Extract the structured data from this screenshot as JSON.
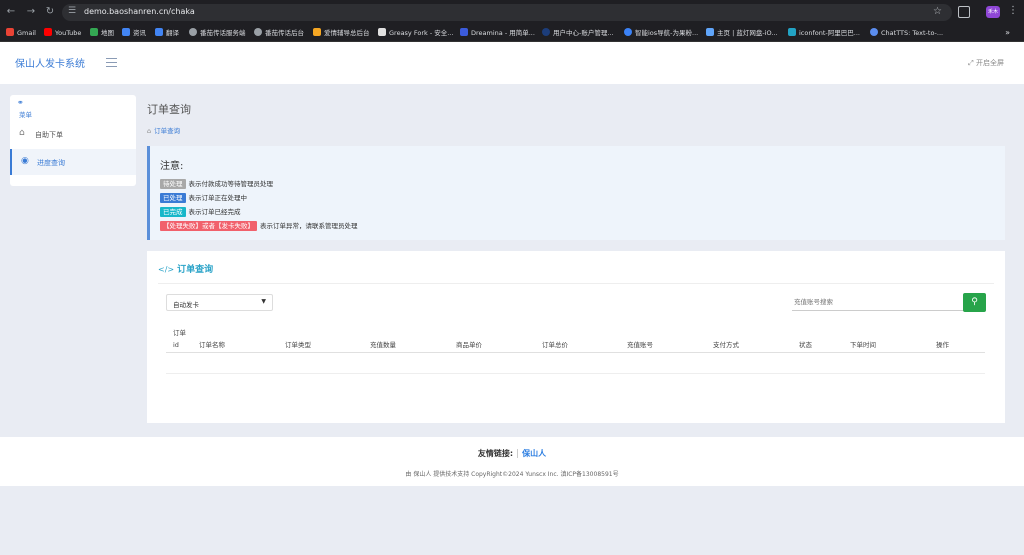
{
  "browser": {
    "url": "demo.baoshanren.cn/chaka",
    "profile_label": "禾木",
    "bookmarks": [
      {
        "label": "Gmail",
        "color": "#ea4335"
      },
      {
        "label": "YouTube",
        "color": "#ff0000"
      },
      {
        "label": "地图",
        "color": "#34a853"
      },
      {
        "label": "资讯",
        "color": "#4285f4"
      },
      {
        "label": "翻译",
        "color": "#4285f4"
      },
      {
        "label": "番茄传话服务端",
        "color": "#9aa0a6"
      },
      {
        "label": "番茄传话后台",
        "color": "#9aa0a6"
      },
      {
        "label": "爱情辅导总后台",
        "color": "#f5a623"
      },
      {
        "label": "Greasy Fork - 安全...",
        "color": "#222222"
      },
      {
        "label": "Dreamina - 用简单...",
        "color": "#3b5bdb"
      },
      {
        "label": "用户中心-账户管理...",
        "color": "#1c3d7a"
      },
      {
        "label": "智能ios导航-为果粉...",
        "color": "#3b82f6"
      },
      {
        "label": "主页 | 蓝灯网盘-iO...",
        "color": "#60a5fa"
      },
      {
        "label": "iconfont-阿里巴巴...",
        "color": "#22a3c4"
      },
      {
        "label": "ChatTTS: Text-to-...",
        "color": "#5b8def"
      }
    ]
  },
  "header": {
    "brand": "保山人发卡系统",
    "fullscreen_label": "开启全屏"
  },
  "sidebar": {
    "menu_label": "菜单",
    "items": [
      {
        "label": "自助下单",
        "icon": "home-icon"
      },
      {
        "label": "进度查询",
        "icon": "eye-icon"
      }
    ]
  },
  "main": {
    "page_title": "订单查询",
    "breadcrumb": "订单查询",
    "notice": {
      "title": "注意:",
      "rows": [
        {
          "badge": "待处理",
          "badge_color": "#a8a8a8",
          "text": "表示付款成功等待管理员处理"
        },
        {
          "badge": "已处理",
          "badge_color": "#3a7bd5",
          "text": "表示订单正在处理中"
        },
        {
          "badge": "已完成",
          "badge_color": "#18b7c9",
          "text": "表示订单已经完成"
        },
        {
          "badge": "【处理失败】或者【发卡失败】",
          "badge_color": "#f1616c",
          "text": "表示订单异常，请联系管理员处理"
        }
      ]
    },
    "query_card": {
      "title": "订单查询",
      "select_value": "自动发卡",
      "search_placeholder": "充值账号搜索",
      "columns": [
        "订单id",
        "订单名称",
        "订单类型",
        "充值数量",
        "商品单价",
        "订单总价",
        "充值账号",
        "支付方式",
        "状态",
        "下单时间",
        "操作"
      ]
    }
  },
  "footer": {
    "friend_label": "友情链接:",
    "friend_link": "保山人",
    "copyright": "由 保山人 提供技术支持    CopyRight©2024 Yunscx Inc.    滇ICP备13008591号"
  }
}
